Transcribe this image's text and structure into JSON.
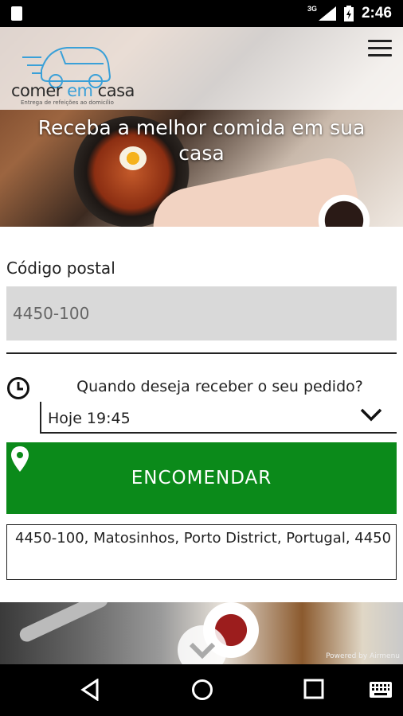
{
  "status_bar": {
    "network": "3G",
    "time": "2:46"
  },
  "header": {
    "logo_word_1": "comer",
    "logo_word_2": "em",
    "logo_word_3": "casa",
    "logo_tagline": "Entrega de refeições ao domicílio",
    "title": "Receba a melhor comida em sua casa"
  },
  "form": {
    "postal_label": "Código postal",
    "postal_value": "4450-100",
    "when_question": "Quando deseja receber o seu pedido?",
    "time_value": "Hoje 19:45",
    "order_button": "ENCOMENDAR",
    "address_value": "4450-100, Matosinhos, Porto District, Portugal, 4450"
  },
  "footer": {
    "powered_by": "Powered by Airmenu"
  },
  "colors": {
    "order_green": "#0b8a1a",
    "logo_blue": "#3aa0d8"
  }
}
